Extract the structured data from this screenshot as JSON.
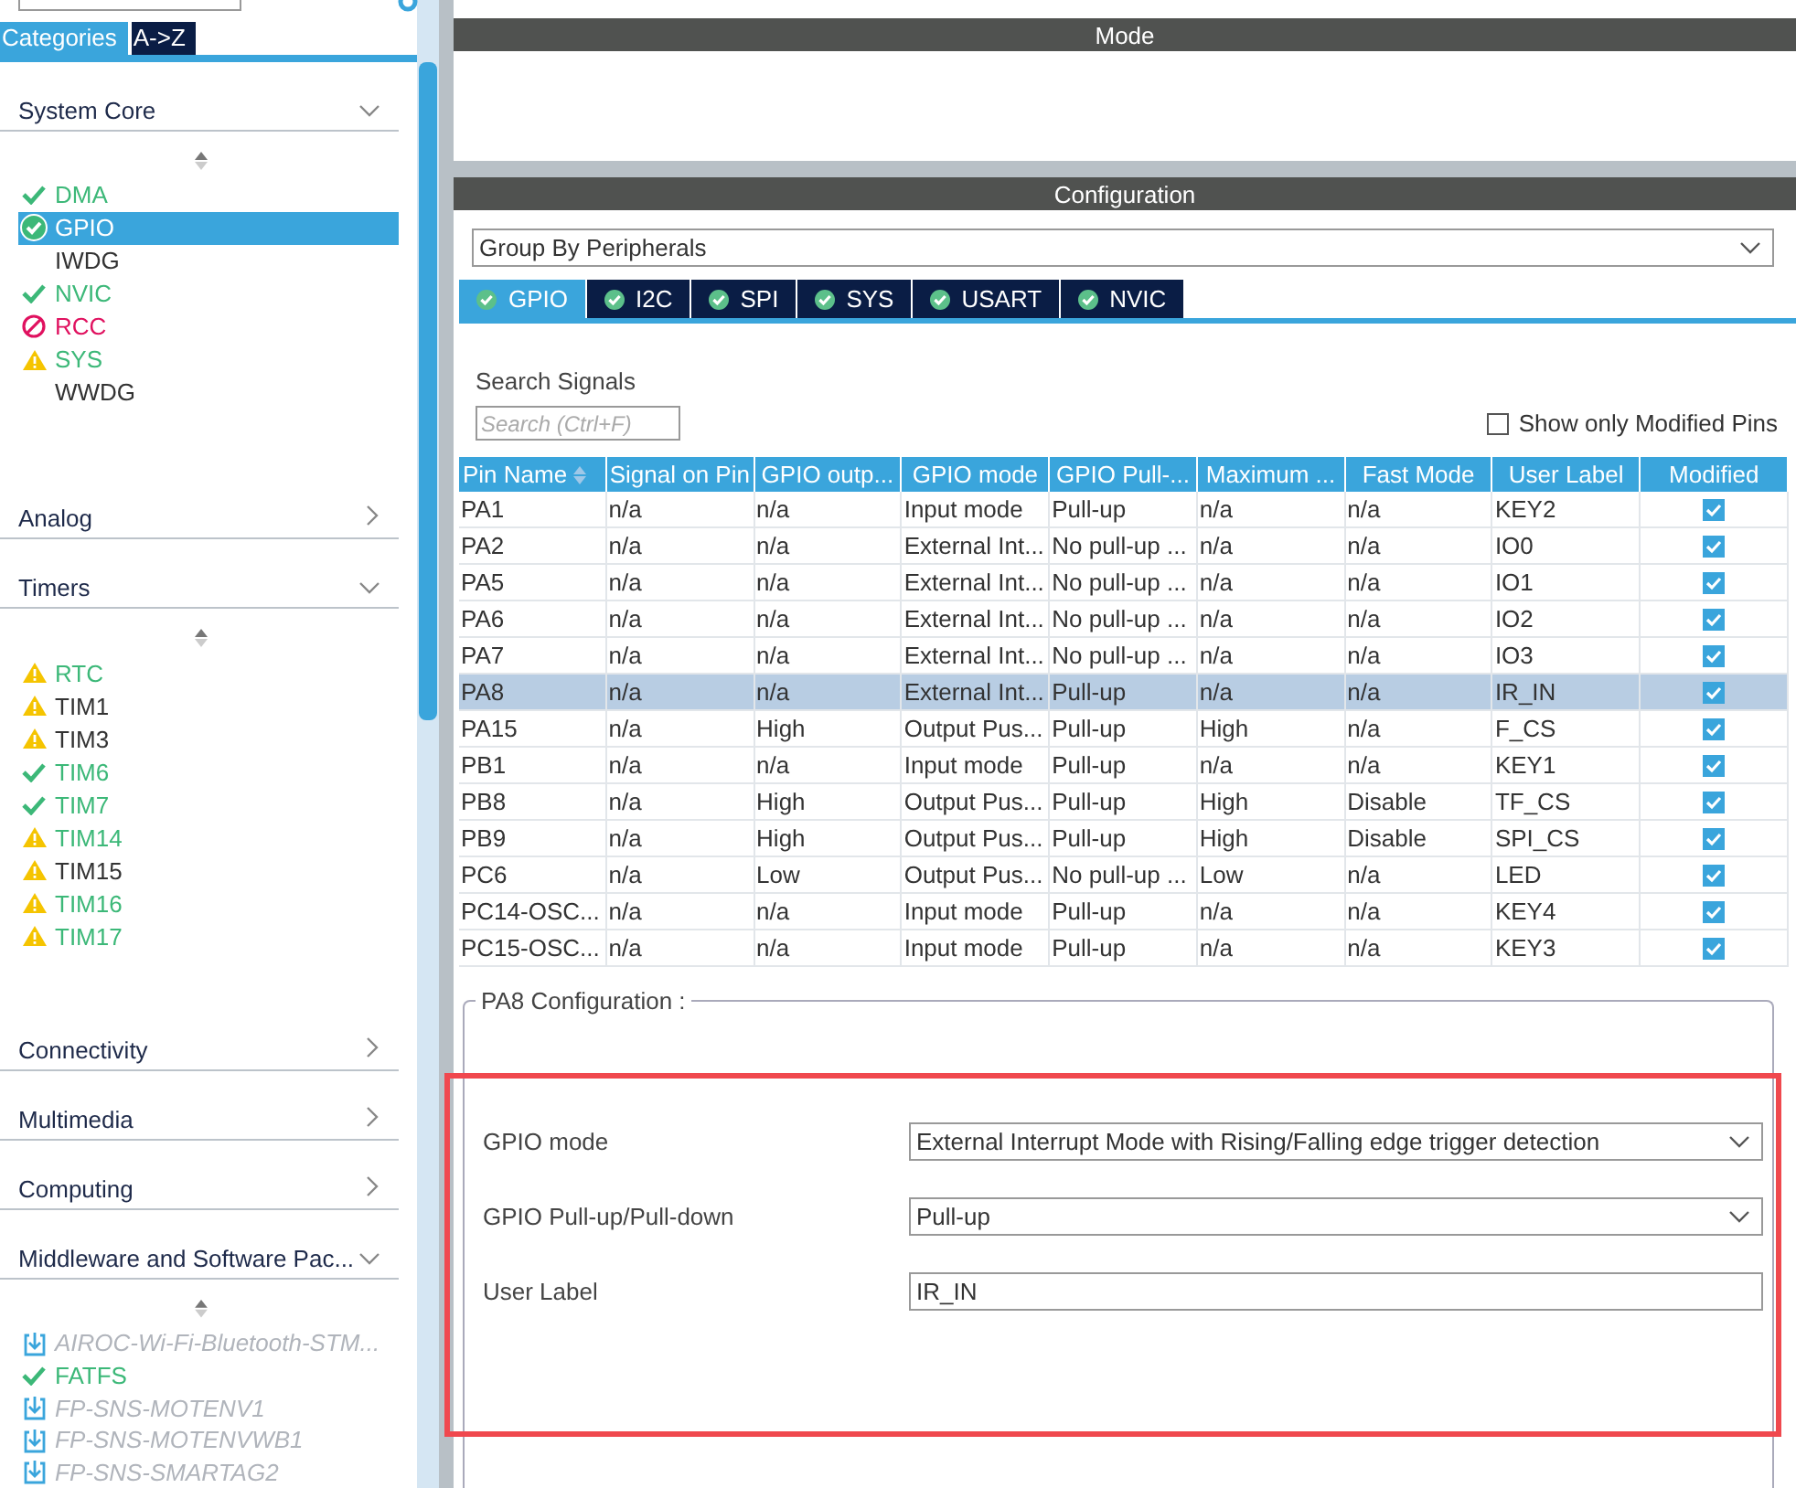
{
  "sidebar": {
    "tabs": [
      {
        "label": "Categories",
        "selected": true
      },
      {
        "label": "A->Z",
        "selected": false
      }
    ],
    "categories": [
      {
        "title": "System Core",
        "expanded": true,
        "items": [
          {
            "label": "DMA",
            "kind": "ok",
            "configured": true,
            "selected": false
          },
          {
            "label": "GPIO",
            "kind": "ok",
            "configured": true,
            "selected": true
          },
          {
            "label": "IWDG",
            "kind": "plain",
            "configured": false,
            "selected": false
          },
          {
            "label": "NVIC",
            "kind": "ok",
            "configured": true,
            "selected": false
          },
          {
            "label": "RCC",
            "kind": "error",
            "configured": false,
            "selected": false
          },
          {
            "label": "SYS",
            "kind": "warning",
            "configured": true,
            "selected": false
          },
          {
            "label": "WWDG",
            "kind": "plain",
            "configured": false,
            "selected": false
          }
        ]
      },
      {
        "title": "Analog",
        "expanded": false
      },
      {
        "title": "Timers",
        "expanded": true,
        "items": [
          {
            "label": "RTC",
            "kind": "warning",
            "configured": true,
            "selected": false
          },
          {
            "label": "TIM1",
            "kind": "warning",
            "configured": false,
            "selected": false
          },
          {
            "label": "TIM3",
            "kind": "warning",
            "configured": false,
            "selected": false
          },
          {
            "label": "TIM6",
            "kind": "ok",
            "configured": true,
            "selected": false
          },
          {
            "label": "TIM7",
            "kind": "ok",
            "configured": true,
            "selected": false
          },
          {
            "label": "TIM14",
            "kind": "warning",
            "configured": true,
            "selected": false
          },
          {
            "label": "TIM15",
            "kind": "warning",
            "configured": false,
            "selected": false
          },
          {
            "label": "TIM16",
            "kind": "warning",
            "configured": true,
            "selected": false
          },
          {
            "label": "TIM17",
            "kind": "warning",
            "configured": true,
            "selected": false
          }
        ]
      },
      {
        "title": "Connectivity",
        "expanded": false
      },
      {
        "title": "Multimedia",
        "expanded": false
      },
      {
        "title": "Computing",
        "expanded": false
      },
      {
        "title": "Middleware and Software Pac...",
        "expanded": true,
        "items": [
          {
            "label": "AIROC-Wi-Fi-Bluetooth-STM...",
            "kind": "download",
            "configured": false,
            "selected": false
          },
          {
            "label": "FATFS",
            "kind": "ok",
            "configured": true,
            "selected": false
          },
          {
            "label": "FP-SNS-MOTENV1",
            "kind": "download",
            "configured": false,
            "selected": false
          },
          {
            "label": "FP-SNS-MOTENVWB1",
            "kind": "download",
            "configured": false,
            "selected": false
          },
          {
            "label": "FP-SNS-SMARTAG2",
            "kind": "download",
            "configured": false,
            "selected": false
          }
        ]
      }
    ]
  },
  "mode": {
    "title": "Mode"
  },
  "configuration": {
    "title": "Configuration",
    "group_by": "Group By Peripherals",
    "tabs": [
      {
        "label": "GPIO",
        "selected": true
      },
      {
        "label": "I2C",
        "selected": false
      },
      {
        "label": "SPI",
        "selected": false
      },
      {
        "label": "SYS",
        "selected": false
      },
      {
        "label": "USART",
        "selected": false
      },
      {
        "label": "NVIC",
        "selected": false
      }
    ],
    "search_label": "Search Signals",
    "search": {
      "placeholder": "Search (Ctrl+F)"
    },
    "show_modified": {
      "label": "Show only Modified Pins",
      "checked": false
    },
    "table": {
      "columns": [
        "Pin Name",
        "Signal on Pin",
        "GPIO outp...",
        "GPIO mode",
        "GPIO Pull-...",
        "Maximum ...",
        "Fast Mode",
        "User Label",
        "Modified"
      ],
      "rows": [
        {
          "cells": [
            "PA1",
            "n/a",
            "n/a",
            "Input mode",
            "Pull-up",
            "n/a",
            "n/a",
            "KEY2"
          ],
          "modified": true,
          "selected": false
        },
        {
          "cells": [
            "PA2",
            "n/a",
            "n/a",
            "External Int...",
            "No pull-up ...",
            "n/a",
            "n/a",
            "IO0"
          ],
          "modified": true,
          "selected": false
        },
        {
          "cells": [
            "PA5",
            "n/a",
            "n/a",
            "External Int...",
            "No pull-up ...",
            "n/a",
            "n/a",
            "IO1"
          ],
          "modified": true,
          "selected": false
        },
        {
          "cells": [
            "PA6",
            "n/a",
            "n/a",
            "External Int...",
            "No pull-up ...",
            "n/a",
            "n/a",
            "IO2"
          ],
          "modified": true,
          "selected": false
        },
        {
          "cells": [
            "PA7",
            "n/a",
            "n/a",
            "External Int...",
            "No pull-up ...",
            "n/a",
            "n/a",
            "IO3"
          ],
          "modified": true,
          "selected": false
        },
        {
          "cells": [
            "PA8",
            "n/a",
            "n/a",
            "External Int...",
            "Pull-up",
            "n/a",
            "n/a",
            "IR_IN"
          ],
          "modified": true,
          "selected": true
        },
        {
          "cells": [
            "PA15",
            "n/a",
            "High",
            "Output Pus...",
            "Pull-up",
            "High",
            "n/a",
            "F_CS"
          ],
          "modified": true,
          "selected": false
        },
        {
          "cells": [
            "PB1",
            "n/a",
            "n/a",
            "Input mode",
            "Pull-up",
            "n/a",
            "n/a",
            "KEY1"
          ],
          "modified": true,
          "selected": false
        },
        {
          "cells": [
            "PB8",
            "n/a",
            "High",
            "Output Pus...",
            "Pull-up",
            "High",
            "Disable",
            "TF_CS"
          ],
          "modified": true,
          "selected": false
        },
        {
          "cells": [
            "PB9",
            "n/a",
            "High",
            "Output Pus...",
            "Pull-up",
            "High",
            "Disable",
            "SPI_CS"
          ],
          "modified": true,
          "selected": false
        },
        {
          "cells": [
            "PC6",
            "n/a",
            "Low",
            "Output Pus...",
            "No pull-up ...",
            "Low",
            "n/a",
            "LED"
          ],
          "modified": true,
          "selected": false
        },
        {
          "cells": [
            "PC14-OSC...",
            "n/a",
            "n/a",
            "Input mode",
            "Pull-up",
            "n/a",
            "n/a",
            "KEY4"
          ],
          "modified": true,
          "selected": false
        },
        {
          "cells": [
            "PC15-OSC...",
            "n/a",
            "n/a",
            "Input mode",
            "Pull-up",
            "n/a",
            "n/a",
            "KEY3"
          ],
          "modified": true,
          "selected": false
        }
      ]
    },
    "pin_config": {
      "title": "PA8 Configuration :",
      "highlighted": true,
      "fields": [
        {
          "label": "GPIO mode",
          "kind": "select",
          "value": "External Interrupt Mode with Rising/Falling edge trigger detection"
        },
        {
          "label": "GPIO Pull-up/Pull-down",
          "kind": "select",
          "value": "Pull-up"
        },
        {
          "label": "User Label",
          "kind": "text",
          "value": "IR_IN"
        }
      ]
    }
  }
}
